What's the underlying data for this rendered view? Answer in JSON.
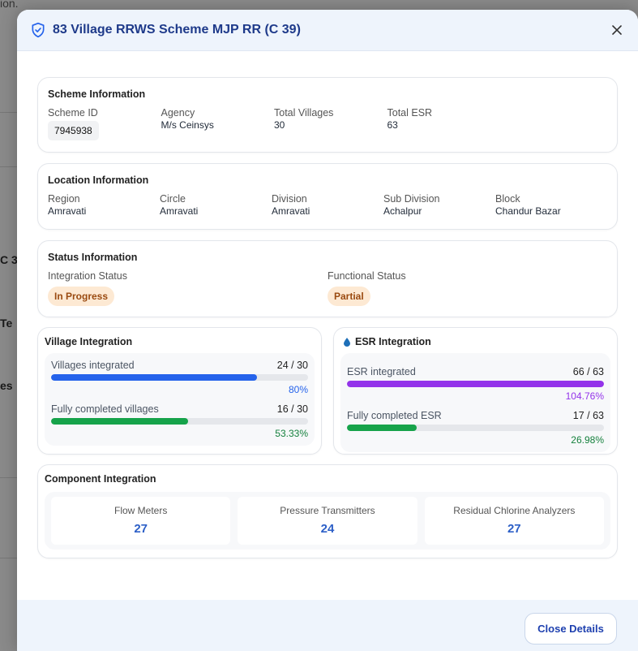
{
  "background": {
    "fragments": [
      "ion.",
      "C 3",
      "Te",
      "es"
    ]
  },
  "modal": {
    "title": "83 Village RRWS Scheme MJP RR (C 39)",
    "header_icon": "shield-check-icon",
    "close_icon": "close-icon"
  },
  "scheme": {
    "section_title": "Scheme Information",
    "fields": [
      {
        "label": "Scheme ID",
        "value": "7945938"
      },
      {
        "label": "Agency",
        "value": "M/s Ceinsys"
      },
      {
        "label": "Total Villages",
        "value": "30"
      },
      {
        "label": "Total ESR",
        "value": "63"
      }
    ]
  },
  "location": {
    "section_title": "Location Information",
    "fields": [
      {
        "label": "Region",
        "value": "Amravati"
      },
      {
        "label": "Circle",
        "value": "Amravati"
      },
      {
        "label": "Division",
        "value": "Amravati"
      },
      {
        "label": "Sub Division",
        "value": "Achalpur"
      },
      {
        "label": "Block",
        "value": "Chandur Bazar"
      }
    ]
  },
  "status": {
    "section_title": "Status Information",
    "integration_label": "Integration Status",
    "integration_value": "In Progress",
    "functional_label": "Functional Status",
    "functional_value": "Partial"
  },
  "village_integration": {
    "title": "Village Integration",
    "rows": [
      {
        "label": "Villages integrated",
        "count": "24 / 30",
        "percent": "80%",
        "fraction": 0.8,
        "color": "#2563eb"
      },
      {
        "label": "Fully completed villages",
        "count": "16 / 30",
        "percent": "53.33%",
        "fraction": 0.5333,
        "color": "#16a34a"
      }
    ]
  },
  "esr_integration": {
    "title": "ESR Integration",
    "icon": "water-drop-icon",
    "rows": [
      {
        "label": "ESR integrated",
        "count": "66 / 63",
        "percent": "104.76%",
        "fraction": 1.0,
        "color": "#9333ea"
      },
      {
        "label": "Fully completed ESR",
        "count": "17 / 63",
        "percent": "26.98%",
        "fraction": 0.2698,
        "color": "#16a34a"
      }
    ]
  },
  "components": {
    "title": "Component Integration",
    "items": [
      {
        "label": "Flow Meters",
        "value": "27"
      },
      {
        "label": "Pressure Transmitters",
        "value": "24"
      },
      {
        "label": "Residual Chlorine Analyzers",
        "value": "27"
      }
    ]
  },
  "footer": {
    "close_button_label": "Close Details"
  },
  "colors": {
    "accent": "#1e40af",
    "pill_bg": "#fde9d3",
    "pill_text": "#9a4a10",
    "percent_blue": "#2563eb",
    "percent_green": "#15803d",
    "percent_purple": "#9333ea"
  }
}
